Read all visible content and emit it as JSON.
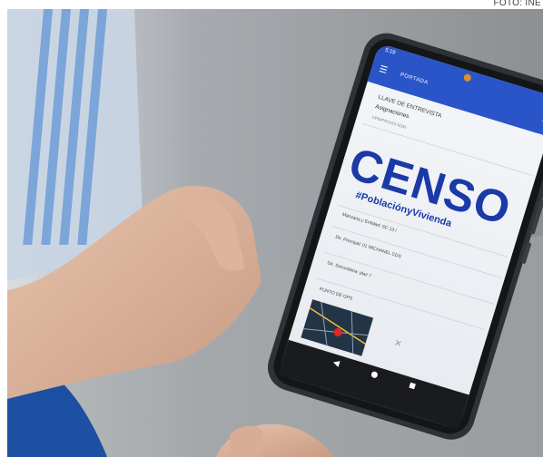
{
  "credit": "FOTO: INE",
  "phone": {
    "status_time": "5:19",
    "app_title": "PORTADA",
    "menu_icon": "menu-icon",
    "more_icon": "more-vert-icon",
    "fields": {
      "llave_label": "LLAVE DE ENTREVISTA",
      "llave_value": "Asignaciones",
      "llave_hint": "UPM/PROGS NÚM",
      "field_4": "Manzana y Entidad: SC 13 /",
      "field_5": "Dir. Principal: 01 MICHANEL CDS",
      "field_6": "Dir. Secundaria: plaz 7",
      "field_7": "PUNTO DE GPS"
    },
    "logo_text": "CENSO",
    "logo_hashtag": "#PoblaciónyVivienda",
    "close_icon": "close-icon"
  },
  "colors": {
    "brand_blue": "#1a3aa8",
    "app_bar": "#2a55c8"
  }
}
